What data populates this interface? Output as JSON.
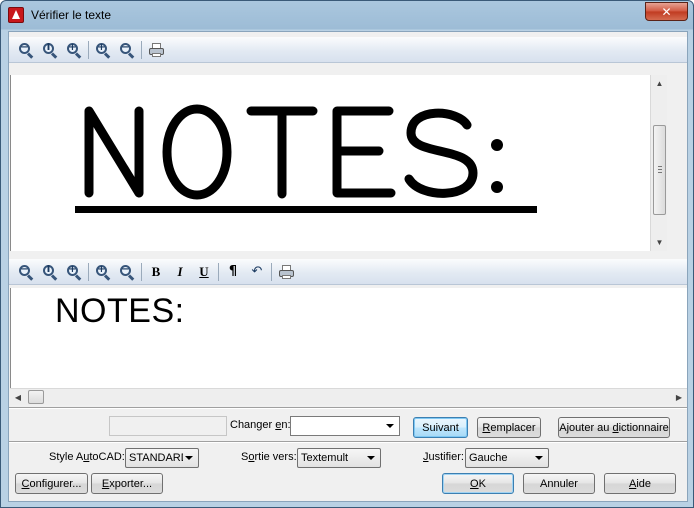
{
  "window": {
    "title": "Vérifier le texte",
    "close_glyph": "✕"
  },
  "toolbar_top": {
    "buttons": [
      "zoom-out-icon",
      "zoom-fit-icon",
      "zoom-in-region-icon",
      "zoom-in-icon",
      "zoom-out-small-icon",
      "print-icon"
    ]
  },
  "image_pane": {
    "scanned_text": "NOTES:"
  },
  "toolbar_bottom": {
    "bold": "B",
    "italic": "I",
    "underline": "U",
    "paragraph": "¶",
    "undo": "↶"
  },
  "text_pane": {
    "recognized_text": "NOTES:"
  },
  "change": {
    "label_before": "Changer ",
    "label_accel": "e",
    "label_after": "n:",
    "value": ""
  },
  "buttons": {
    "next": "Suivant",
    "replace_accel": "R",
    "replace_rest": "emplacer",
    "add_dict_before": "Ajouter au ",
    "add_dict_accel": "d",
    "add_dict_after": "ictionnaire",
    "configure_accel": "C",
    "configure_rest": "onfigurer...",
    "export_accel": "E",
    "export_rest": "xporter...",
    "ok_accel": "O",
    "ok_rest": "K",
    "cancel": "Annuler",
    "help_accel": "A",
    "help_rest": "ide"
  },
  "options": {
    "style_label_before": "Style A",
    "style_label_accel": "u",
    "style_label_after": "toCAD:",
    "style_value": "STANDARD",
    "output_label_before": "S",
    "output_label_accel": "o",
    "output_label_after": "rtie vers:",
    "output_value": "Textemult",
    "justify_label_before": "",
    "justify_label_accel": "J",
    "justify_label_after": "ustifier:",
    "justify_value": "Gauche"
  }
}
